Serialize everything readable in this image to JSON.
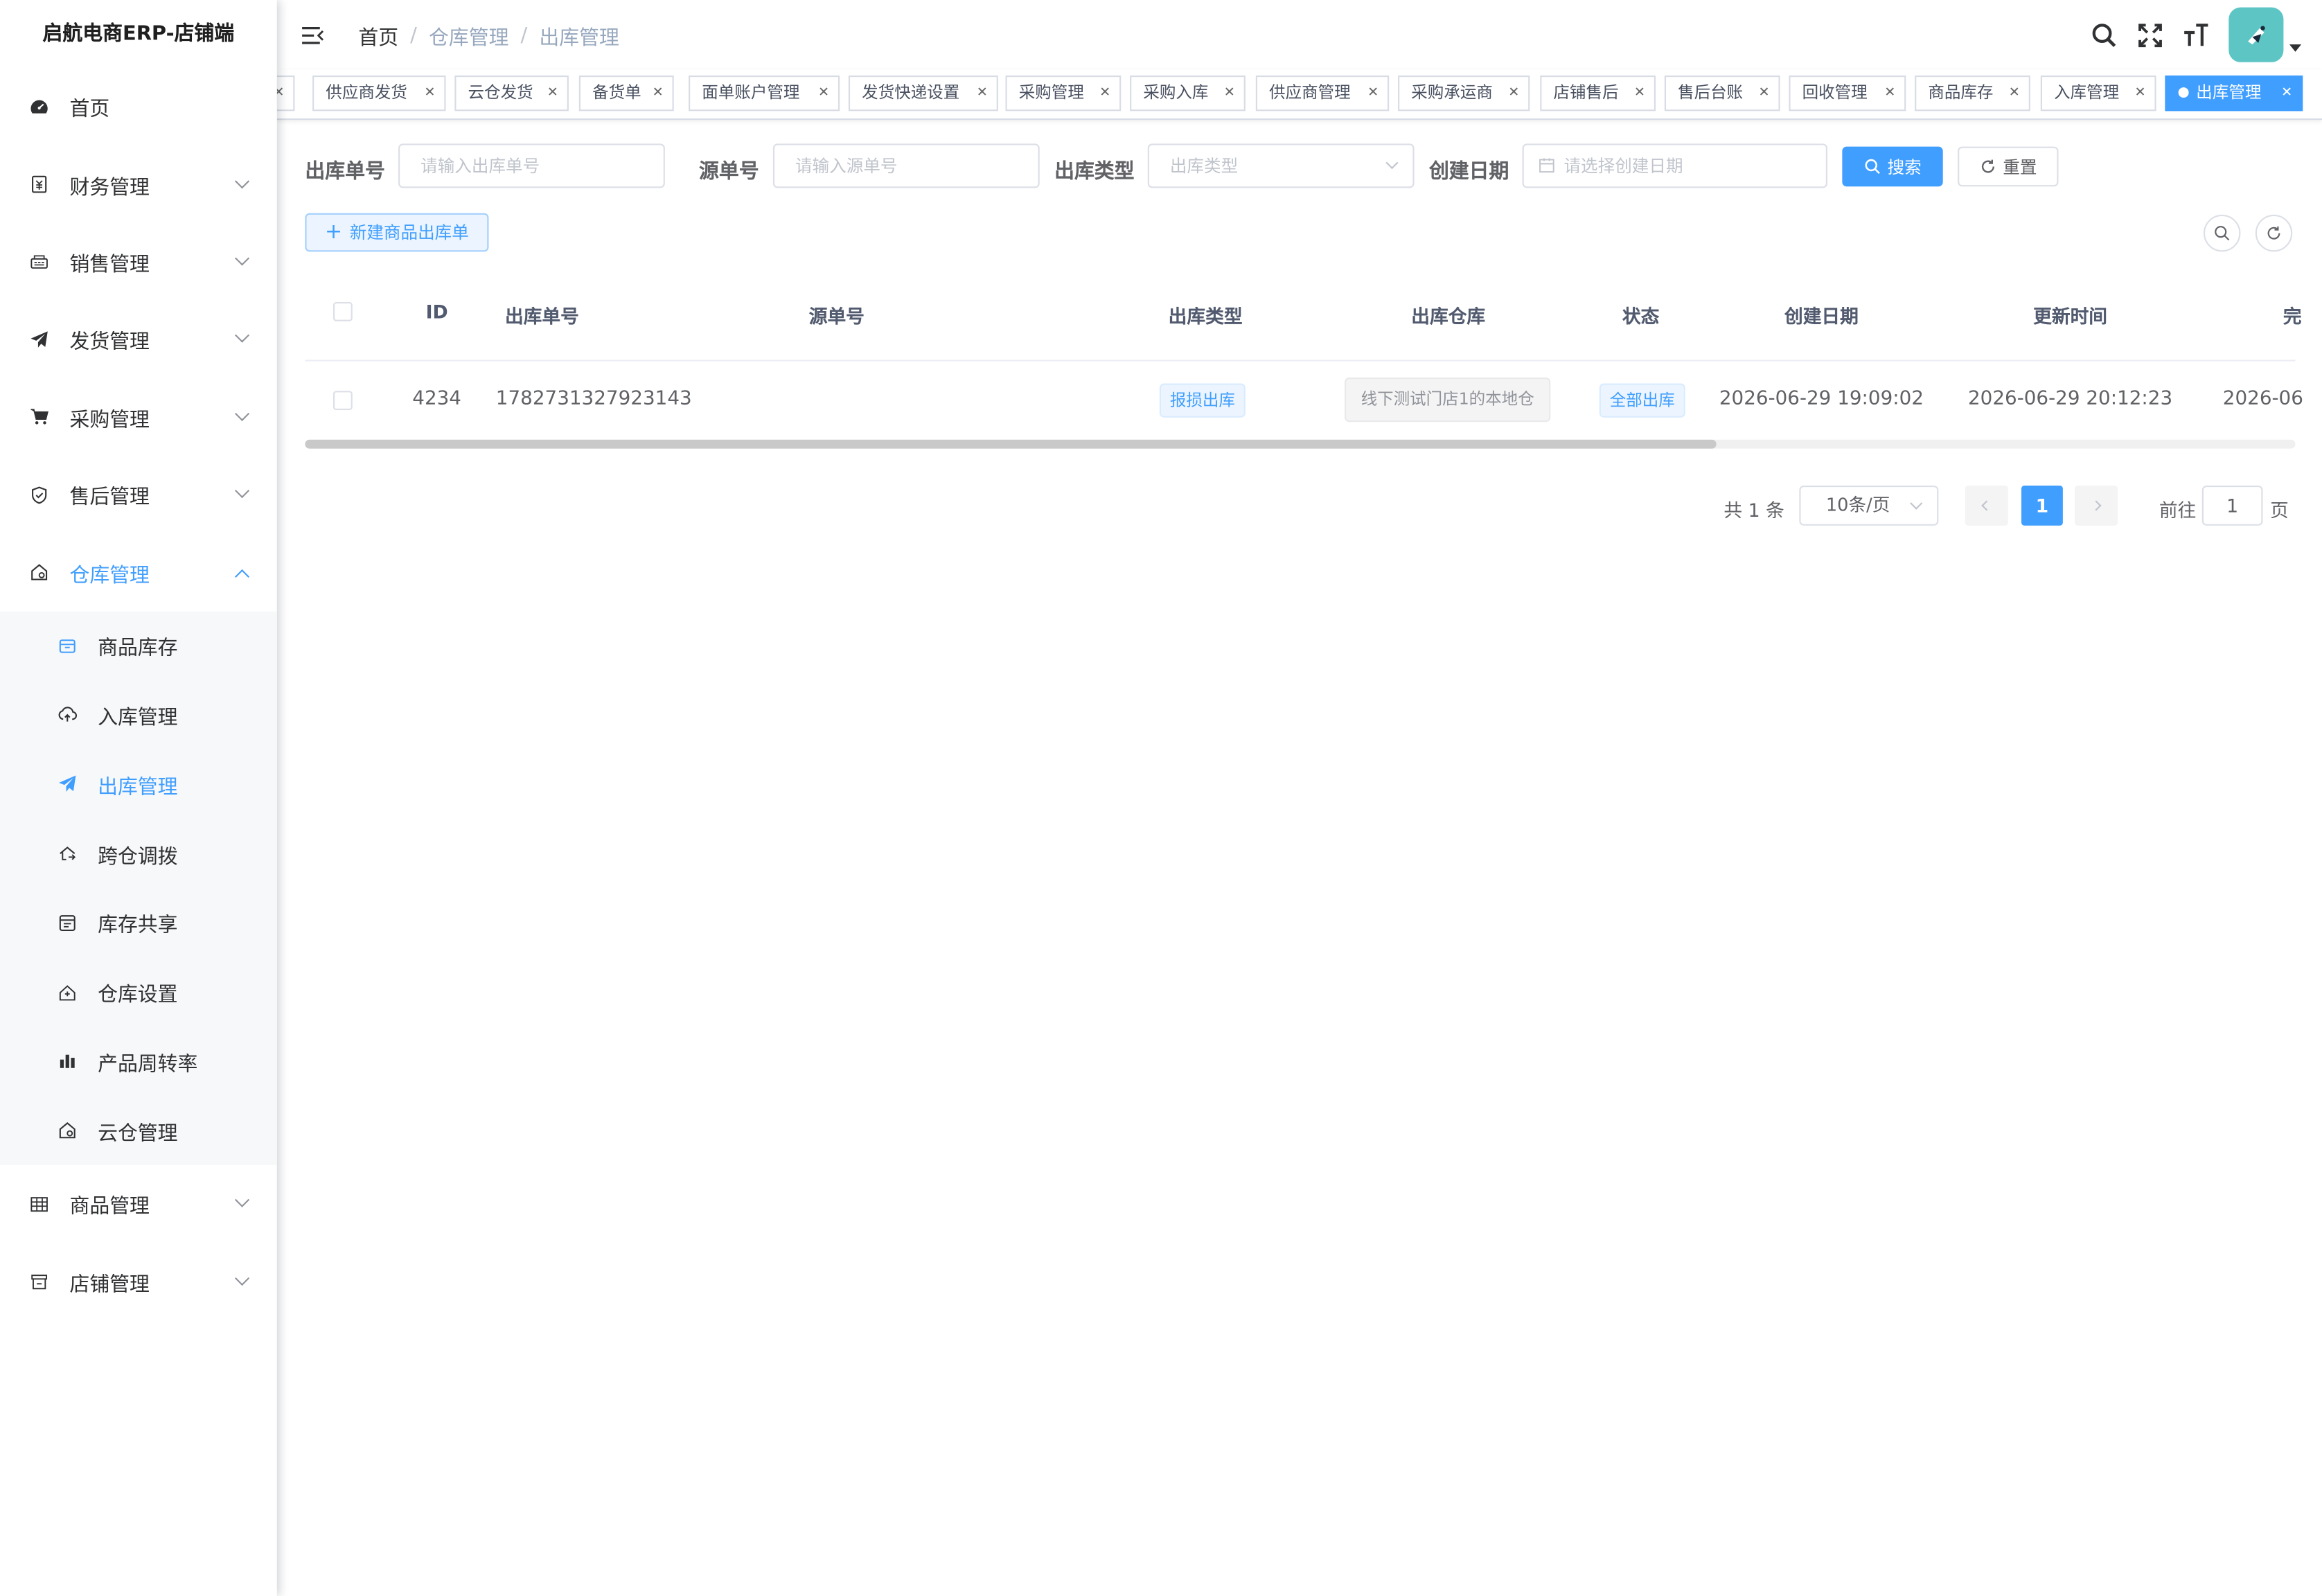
{
  "sidebar": {
    "title": "启航电商ERP-店铺端",
    "menu": [
      {
        "label": "首页",
        "icon": "dashboard-icon"
      },
      {
        "label": "财务管理",
        "icon": "finance-icon"
      },
      {
        "label": "销售管理",
        "icon": "sales-icon"
      },
      {
        "label": "发货管理",
        "icon": "paper-plane-icon"
      },
      {
        "label": "采购管理",
        "icon": "cart-icon"
      },
      {
        "label": "售后管理",
        "icon": "shield-icon"
      },
      {
        "label": "仓库管理",
        "icon": "warehouse-icon"
      }
    ],
    "warehouse_submenu": [
      {
        "label": "商品库存",
        "icon": "inventory-icon"
      },
      {
        "label": "入库管理",
        "icon": "cloud-upload-icon"
      },
      {
        "label": "出库管理",
        "icon": "paper-plane-icon"
      },
      {
        "label": "跨仓调拨",
        "icon": "transfer-icon"
      },
      {
        "label": "库存共享",
        "icon": "share-icon"
      },
      {
        "label": "仓库设置",
        "icon": "home-settings-icon"
      },
      {
        "label": "产品周转率",
        "icon": "bar-chart-icon"
      },
      {
        "label": "云仓管理",
        "icon": "cloud-warehouse-icon"
      }
    ],
    "menu_after": [
      {
        "label": "商品管理",
        "icon": "table-icon"
      },
      {
        "label": "店铺管理",
        "icon": "shop-icon"
      }
    ]
  },
  "breadcrumb": [
    "首页",
    "仓库管理",
    "出库管理"
  ],
  "tags": [
    "供应商发货",
    "云仓发货",
    "备货单",
    "面单账户管理",
    "发货快递设置",
    "采购管理",
    "采购入库",
    "供应商管理",
    "采购承运商",
    "店铺售后",
    "售后台账",
    "回收管理",
    "商品库存",
    "入库管理",
    "出库管理"
  ],
  "filter": {
    "outbound_no_label": "出库单号",
    "outbound_no_placeholder": "请输入出库单号",
    "source_no_label": "源单号",
    "source_no_placeholder": "请输入源单号",
    "type_label": "出库类型",
    "type_placeholder": "出库类型",
    "date_label": "创建日期",
    "date_placeholder": "请选择创建日期",
    "search_btn": "搜索",
    "reset_btn": "重置"
  },
  "toolbar": {
    "new_btn": "新建商品出库单"
  },
  "table": {
    "headers": [
      "ID",
      "出库单号",
      "源单号",
      "出库类型",
      "出库仓库",
      "状态",
      "创建日期",
      "更新时间",
      "完"
    ],
    "rows": [
      {
        "id": "4234",
        "outbound_no": "1782731327923143",
        "source_no": "",
        "type": "报损出库",
        "warehouse": "线下测试门店1的本地仓",
        "status": "全部出库",
        "created": "2026-06-29 19:09:02",
        "updated": "2026-06-29 20:12:23",
        "completed": "2026-06"
      }
    ]
  },
  "pagination": {
    "total": "共 1 条",
    "page_size": "10条/页",
    "current": "1",
    "goto_label": "前往",
    "goto_value": "1",
    "page_unit": "页"
  },
  "colors": {
    "primary": "#409eff",
    "avatar": "#5ec5c5"
  }
}
